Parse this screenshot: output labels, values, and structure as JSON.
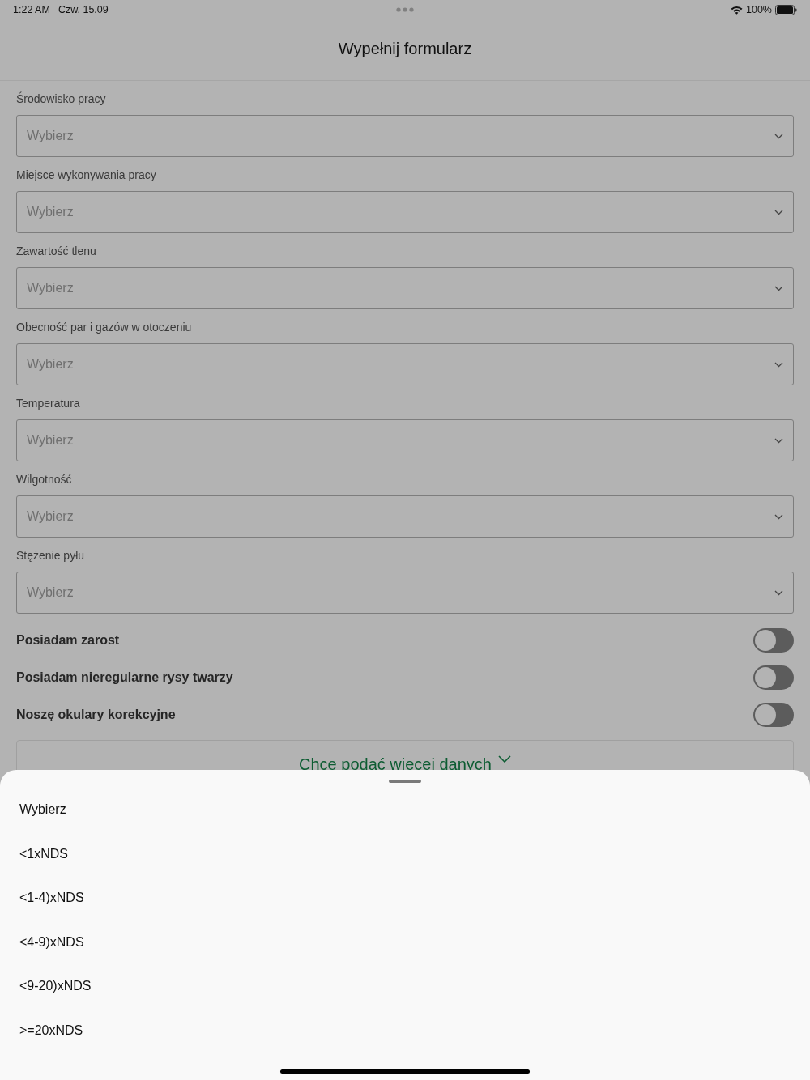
{
  "status_bar": {
    "time": "1:22 AM",
    "date": "Czw. 15.09",
    "battery": "100%"
  },
  "header": {
    "title": "Wypełnij formularz"
  },
  "fields": [
    {
      "label": "Środowisko pracy",
      "placeholder": "Wybierz"
    },
    {
      "label": "Miejsce wykonywania pracy",
      "placeholder": "Wybierz"
    },
    {
      "label": "Zawartość tlenu",
      "placeholder": "Wybierz"
    },
    {
      "label": "Obecność par i gazów w otoczeniu",
      "placeholder": "Wybierz"
    },
    {
      "label": "Temperatura",
      "placeholder": "Wybierz"
    },
    {
      "label": "Wilgotność",
      "placeholder": "Wybierz"
    },
    {
      "label": "Stężenie pyłu",
      "placeholder": "Wybierz"
    }
  ],
  "toggles": [
    {
      "label": "Posiadam zarost",
      "on": false
    },
    {
      "label": "Posiadam nieregularne rysy twarzy",
      "on": false
    },
    {
      "label": "Noszę okulary korekcyjne",
      "on": false
    }
  ],
  "more_button": {
    "label": "Chce podać więcej danych"
  },
  "sheet": {
    "options": [
      "Wybierz",
      "<1xNDS",
      "<1-4)xNDS",
      "<4-9)xNDS",
      "<9-20)xNDS",
      ">=20xNDS"
    ]
  }
}
